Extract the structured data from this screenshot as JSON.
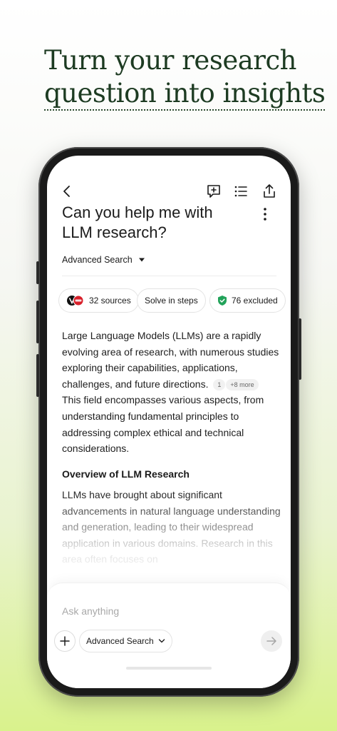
{
  "headline": {
    "line1": "Turn your research",
    "line2": "question into insights"
  },
  "screen": {
    "toolbar": {
      "back_icon": "chevron-left-icon",
      "new_thread_icon": "chat-plus-icon",
      "list_icon": "list-icon",
      "share_icon": "share-icon"
    },
    "title": "Can you help me with LLM research?",
    "more_icon": "vertical-dots-icon",
    "mode": {
      "label": "Advanced Search",
      "icon": "caret-down-icon"
    },
    "chips": {
      "sources": "32 sources",
      "steps": "Solve in steps",
      "excluded": "76 excluded"
    },
    "answer": {
      "para1": "Large Language Models (LLMs) are a rapidly evolving area of research, with numerous studies exploring their capabilities, applications, challenges, and future directions.",
      "cite_num": "1",
      "cite_more": "+8 more",
      "para1b": "This field encompasses various aspects, from understanding fundamental principles to addressing complex ethical and technical considerations.",
      "section_title": "Overview of LLM Research",
      "para2": "LLMs have brought about significant advancements in natural language understanding and generation, leading to their widespread application in various domains. Research in this area often focuses on"
    },
    "composer": {
      "placeholder": "Ask anything",
      "mode_label": "Advanced Search"
    }
  },
  "colors": {
    "headline": "#1d3b22",
    "accent_green": "#d9f28c",
    "shield_green": "#22a35a"
  }
}
